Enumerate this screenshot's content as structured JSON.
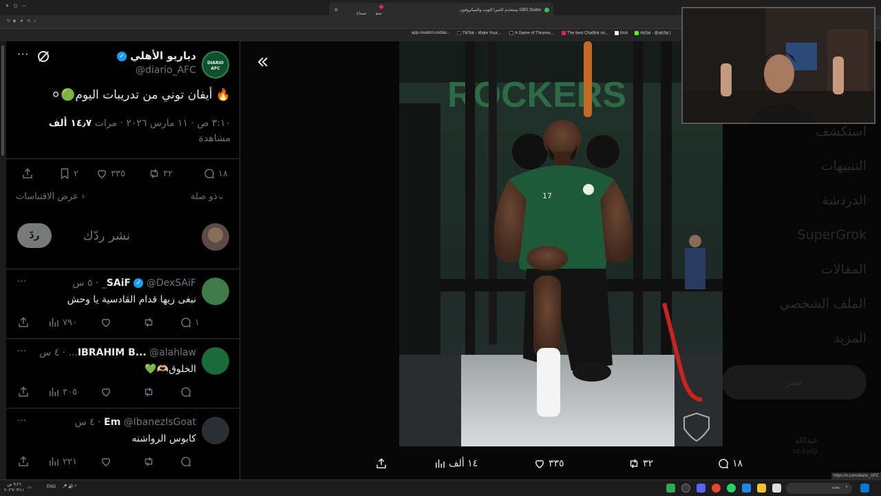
{
  "browser": {
    "obs_notice": "OBS Studio يستخدم كاميرا الويب والميكروفون",
    "obs_buttons": [
      "سماح",
      "منع"
    ],
    "bookmarks": [
      "app.creators.io/das...",
      "TikTok - Make Your...",
      "A Game of Thrones...",
      "The best ChatBot on...",
      "Kick",
      "Ab3al - @ab3al |"
    ]
  },
  "tweet": {
    "author_name": "دياريو الأهلي",
    "author_handle": "@diario_AFC",
    "avatar_text": "DIARIO AFC",
    "text": "🔥 أيفان توني من تدريبات اليوم🟢⚪",
    "meta_time": "٣:١٠ ص · ١١ مارس ٢٠٢٦ · مرات",
    "views_count": "١٤٫٧ ألف",
    "views_label": "مشاهدة",
    "replies": "١٨",
    "retweets": "٣٢",
    "likes": "٣٣٥",
    "bookmarks": "٢",
    "related_label": "ذو صلة",
    "quotes_label": "عرض الاقتباسات",
    "reply_placeholder": "نشر ردّك",
    "reply_button": "ردّ"
  },
  "replies": [
    {
      "name": "SAiF",
      "verified": true,
      "handle": "@DexSAiF_",
      "time": "٥ س",
      "text": "نبغى زيها قدام القادسية يا وحش",
      "replies": "١",
      "views": "٧٩٠"
    },
    {
      "name": "IBRAHIM B...",
      "verified": false,
      "handle": "@alahlaw...",
      "time": "٤ س",
      "text": "الخلوق🫶🏼💚",
      "replies": "",
      "views": "٣٠٥"
    },
    {
      "name": "Em",
      "verified": false,
      "handle": "@IbanezIsGoat",
      "time": "٤ س",
      "text": "كابوس الرواشنه",
      "replies": "",
      "views": "٢٢١"
    }
  ],
  "media": {
    "replies": "١٨",
    "retweets": "٣٢",
    "likes": "٣٣٥",
    "views": "١٤ ألف",
    "gym_sign": "ROCKERS"
  },
  "background_nav": {
    "items": [
      "استكشف",
      "التنبيهات",
      "الدردشة",
      "SuperGrok",
      "المقالات",
      "الملف الشخصي",
      "المزيد"
    ],
    "post_button": "نشر",
    "account_name": "عبدالله",
    "account_handle": "@ab3al"
  },
  "status_url": "https://x.com/diario_AFC",
  "taskbar": {
    "lang": "ENG",
    "search_placeholder": "بحث",
    "time": "٩:٢٦ ص",
    "date": "٢٠٢٦/٠٣/١١"
  },
  "colors": {
    "accent_blue": "#1d9bf0",
    "jersey_green": "#1f5a38",
    "bg": "#000000"
  }
}
